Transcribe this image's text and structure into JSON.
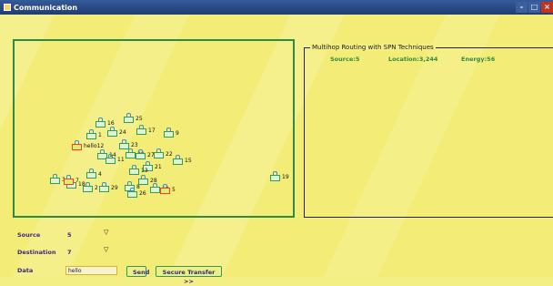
{
  "window": {
    "title": "Communication"
  },
  "routing": {
    "title": "Multihop Routing with SPN Techniques",
    "source_label": "Source:5",
    "location_label": "Location:3,244",
    "energy_label": "Energy:56"
  },
  "form": {
    "source_label": "Source",
    "source_value": "5",
    "destination_label": "Destination",
    "destination_value": "7",
    "data_label": "Data",
    "data_value": "hello",
    "send_label": "Send",
    "secure_label": "Secure Transfer >>"
  },
  "nodes": [
    {
      "id": "16",
      "label": "16"
    },
    {
      "id": "25",
      "label": "25"
    },
    {
      "id": "24",
      "label": "24"
    },
    {
      "id": "17",
      "label": "17"
    },
    {
      "id": "9",
      "label": "9"
    },
    {
      "id": "1",
      "label": "1"
    },
    {
      "id": "12",
      "label": "hello12"
    },
    {
      "id": "23",
      "label": "23"
    },
    {
      "id": "14",
      "label": "14"
    },
    {
      "id": "11",
      "label": "11"
    },
    {
      "id": "20",
      "label": "20"
    },
    {
      "id": "27",
      "label": "27"
    },
    {
      "id": "22",
      "label": "22"
    },
    {
      "id": "15",
      "label": "15"
    },
    {
      "id": "21",
      "label": "21"
    },
    {
      "id": "13",
      "label": "13"
    },
    {
      "id": "4",
      "label": "4"
    },
    {
      "id": "18",
      "label": "18"
    },
    {
      "id": "2",
      "label": "2"
    },
    {
      "id": "29",
      "label": "29"
    },
    {
      "id": "8",
      "label": "8"
    },
    {
      "id": "26",
      "label": "26"
    },
    {
      "id": "10",
      "label": "10"
    },
    {
      "id": "5",
      "label": "5"
    },
    {
      "id": "3",
      "label": "3"
    },
    {
      "id": "7",
      "label": "7"
    },
    {
      "id": "28",
      "label": "28"
    },
    {
      "id": "19",
      "label": "19"
    }
  ]
}
